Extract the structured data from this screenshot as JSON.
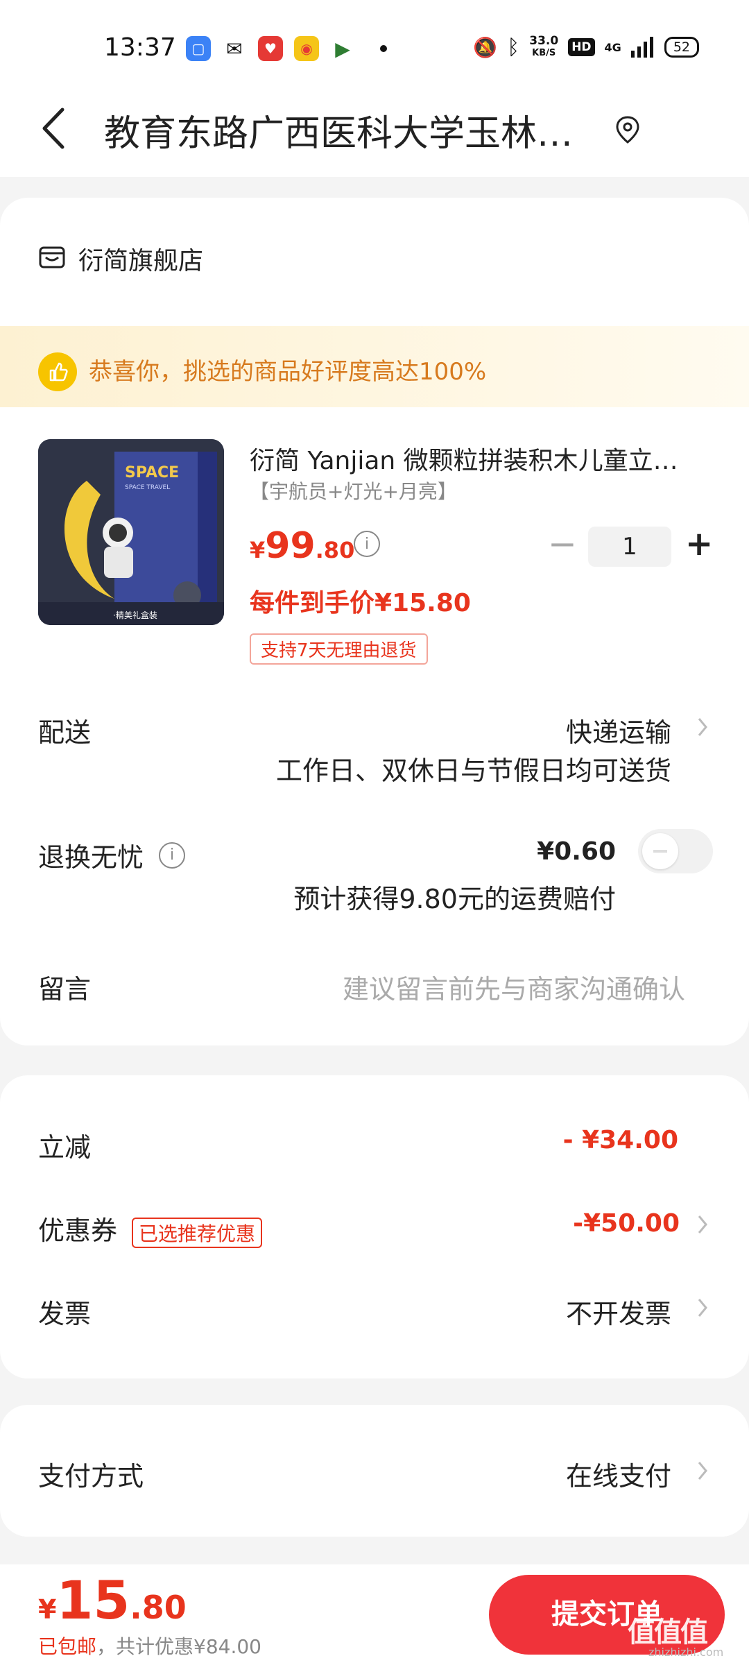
{
  "status_bar": {
    "time": "13:37",
    "net_speed_top": "33.0",
    "net_speed_unit": "KB/S",
    "hd": "HD",
    "signal": "4G",
    "battery": "52"
  },
  "nav": {
    "title": "教育东路广西医科大学玉林…"
  },
  "store": {
    "name": "衍简旗舰店"
  },
  "banner": {
    "text": "恭喜你，挑选的商品好评度高达100%"
  },
  "product": {
    "title": "衍简 Yanjian 微颗粒拼装积木儿童立…",
    "spec": "【宇航员+灯光+月亮】",
    "price_symbol": "¥",
    "price_int": "99",
    "price_dec": ".80",
    "quantity": "1",
    "hand_price": "每件到手价¥15.80",
    "return_tag": "支持7天无理由退货",
    "image_text_top": "SPACE",
    "image_text_sub": "SPACE TRAVEL",
    "image_caption": "·精美礼盒装"
  },
  "delivery": {
    "label": "配送",
    "value": "快递运输",
    "sub": "工作日、双休日与节假日均可送货"
  },
  "return_insurance": {
    "label": "退换无忧",
    "price": "¥0.60",
    "sub": "预计获得9.80元的运费赔付"
  },
  "message": {
    "label": "留言",
    "placeholder": "建议留言前先与商家沟通确认"
  },
  "discounts": {
    "instant_label": "立减",
    "instant_value": "- ¥34.00",
    "coupon_label": "优惠券",
    "coupon_tag": "已选推荐优惠",
    "coupon_value": "-¥50.00",
    "invoice_label": "发票",
    "invoice_value": "不开发票"
  },
  "payment": {
    "label": "支付方式",
    "value": "在线支付"
  },
  "footer": {
    "total_symbol": "¥",
    "total_int": "15",
    "total_dec": ".80",
    "sub_prefix": "已包邮",
    "sub_rest": "，共计优惠¥84.00",
    "submit_label": "提交订单",
    "watermark": "值值值",
    "watermark_sub": "zhizhizhi.com"
  },
  "colors": {
    "accent": "#e8341d",
    "submit_bg": "#f0333a",
    "banner_text": "#d77a1e"
  }
}
